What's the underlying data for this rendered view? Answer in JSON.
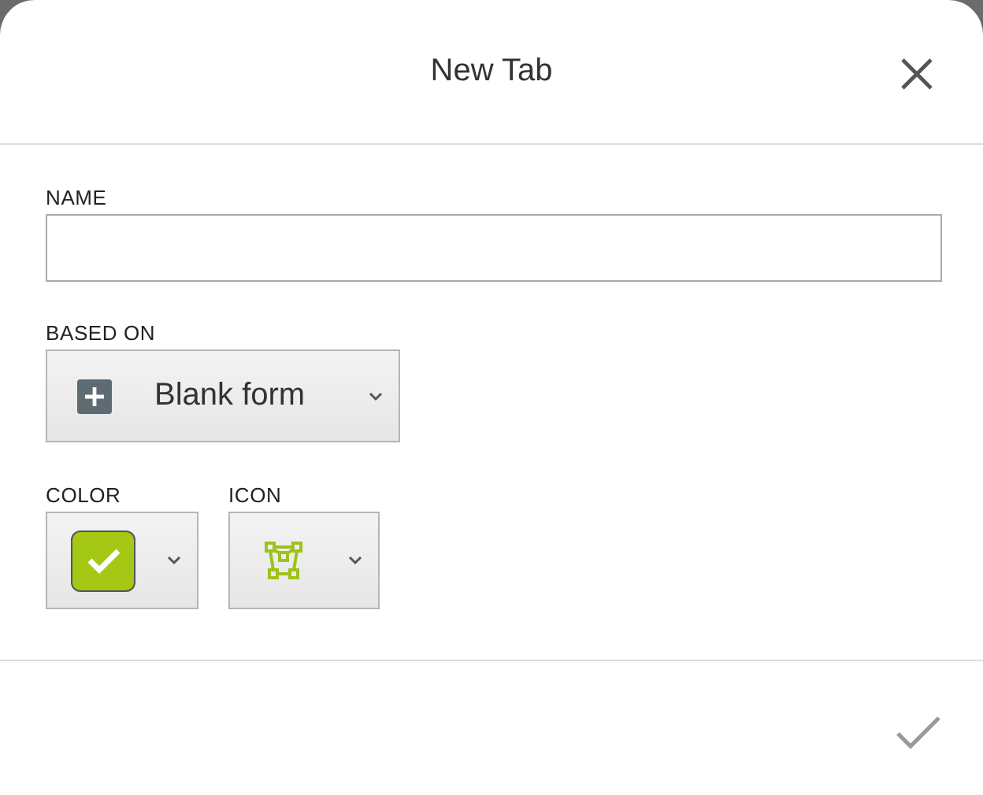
{
  "dialog": {
    "title": "New Tab"
  },
  "name_field": {
    "label": "NAME"
  },
  "based_on": {
    "label": "BASED ON",
    "value": "Blank form"
  },
  "color_picker": {
    "label": "COLOR",
    "color": "#a5c814"
  },
  "icon_picker": {
    "label": "ICON"
  },
  "confirm_button": {
    "disabled": true
  }
}
